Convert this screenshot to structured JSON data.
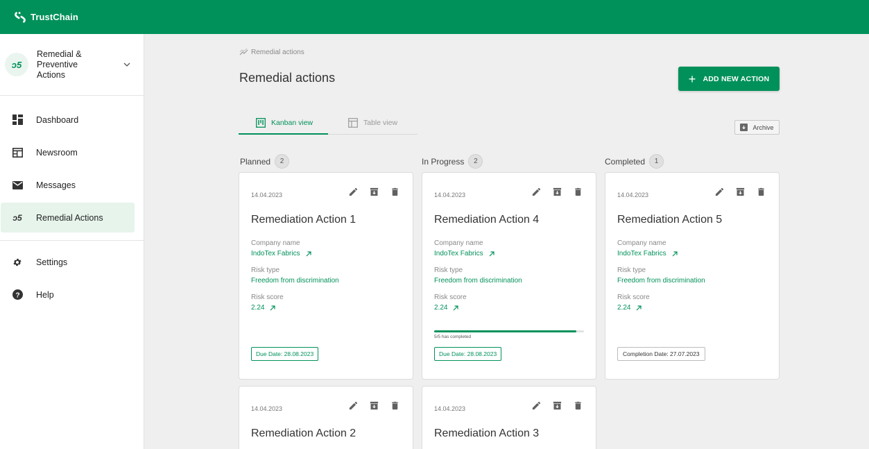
{
  "app": {
    "name": "TrustChain"
  },
  "sidebar": {
    "module_label": "Remedial & Preventive Actions",
    "module_badge": "↻",
    "items": [
      {
        "label": "Dashboard",
        "icon": "dashboard-icon"
      },
      {
        "label": "Newsroom",
        "icon": "newsroom-icon"
      },
      {
        "label": "Messages",
        "icon": "mail-icon"
      },
      {
        "label": "Remedial Actions",
        "icon": "remedial-icon",
        "active": true
      }
    ],
    "bottom_items": [
      {
        "label": "Settings",
        "icon": "gear-icon"
      },
      {
        "label": "Help",
        "icon": "help-icon"
      }
    ]
  },
  "header": {
    "breadcrumb": "Remedial actions",
    "title": "Remedial actions",
    "add_button": "ADD NEW ACTION"
  },
  "tabs": [
    {
      "label": "Kanban view",
      "active": true
    },
    {
      "label": "Table view",
      "active": false
    }
  ],
  "archive_label": "Archive",
  "columns": [
    {
      "title": "Planned",
      "count": "2"
    },
    {
      "title": "In Progress",
      "count": "2"
    },
    {
      "title": "Completed",
      "count": "1"
    }
  ],
  "field_labels": {
    "company": "Company name",
    "risk_type": "Risk type",
    "risk_score": "Risk score"
  },
  "cards": [
    {
      "date": "14.04.2023",
      "title": "Remediation Action 1",
      "company": "IndoTex Fabrics",
      "risk_type": "Freedom from discrimination",
      "risk_score": "2.24",
      "due": "Due Date: 28.08.2023"
    },
    {
      "date": "14.04.2023",
      "title": "Remediation Action 4",
      "company": "IndoTex Fabrics",
      "risk_type": "Freedom from discrimination",
      "risk_score": "2.24",
      "progress_text": "5/5 has completed",
      "progress": 0.95,
      "due": "Due Date: 28.08.2023"
    },
    {
      "date": "14.04.2023",
      "title": "Remediation Action 5",
      "company": "IndoTex Fabrics",
      "risk_type": "Freedom from discrimination",
      "risk_score": "2.24",
      "completion": "Completion Date: 27.07.2023"
    },
    {
      "date": "14.04.2023",
      "title": "Remediation Action 2"
    },
    {
      "date": "14.04.2023",
      "title": "Remediation Action 3"
    }
  ],
  "colors": {
    "brand": "#00915a",
    "active_bg": "#e6f4ec"
  }
}
